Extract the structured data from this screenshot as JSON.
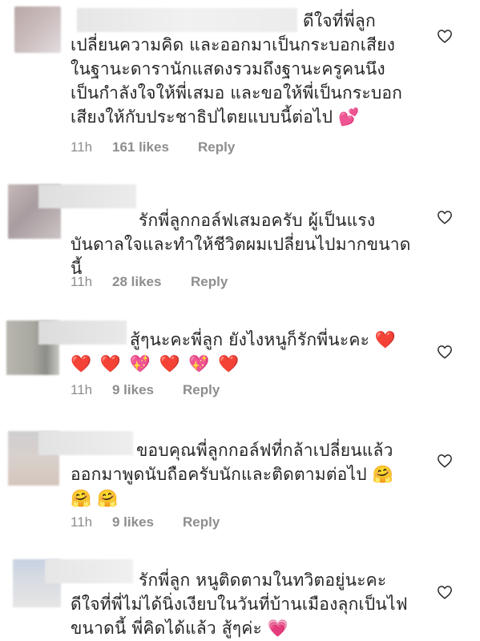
{
  "comments": [
    {
      "lines": [
        "ดีใจที่พี่ลูก",
        "เปลี่ยนความคิด และออกมาเป็นกระบอกเสียง",
        "ในฐานะดารานักแสดงรวมถึงฐานะครูคนนึง",
        "เป็นกำลังใจให้พี่เสมอ และขอให้พี่เป็นกระบอก",
        "เสียงให้กับประชาธิปไตยแบบนี้ต่อไป 💕"
      ],
      "time": "11h",
      "likes": "161 likes",
      "reply": "Reply"
    },
    {
      "lines": [
        "รักพี่ลูกกอล์ฟเสมอครับ ผู้เป็นแรง",
        "บันดาลใจและทำให้ชีวิตผมเปลี่ยนไปมากขนาด",
        "นี้"
      ],
      "time": "11h",
      "likes": "28 likes",
      "reply": "Reply"
    },
    {
      "lines": [
        "สู้ๆนะคะพี่ลูก ยังไงหนูก็รักพี่นะคะ ❤️",
        "❤️ ❤️ 💖 ❤️ 💖 ❤️"
      ],
      "time": "11h",
      "likes": "9 likes",
      "reply": "Reply"
    },
    {
      "lines": [
        "ขอบคุณพี่ลูกกอล์ฟที่กล้าเปลี่ยนแล้ว",
        "ออกมาพูดนับถือครับนักและติดตามต่อไป 🤗",
        "🤗 🤗"
      ],
      "time": "11h",
      "likes": "9 likes",
      "reply": "Reply"
    },
    {
      "lines": [
        "รักพี่ลูก หนูติดตามในทวิตอยู่นะคะ",
        "ดีใจที่พี่ไม่ได้นิ่งเงียบในวันที่บ้านเมืองลุกเป็นไฟ",
        "ขนาดนี้ พี่คิดได้แล้ว สู้ๆค่ะ 💗"
      ],
      "time": "",
      "likes": "",
      "reply": ""
    }
  ]
}
